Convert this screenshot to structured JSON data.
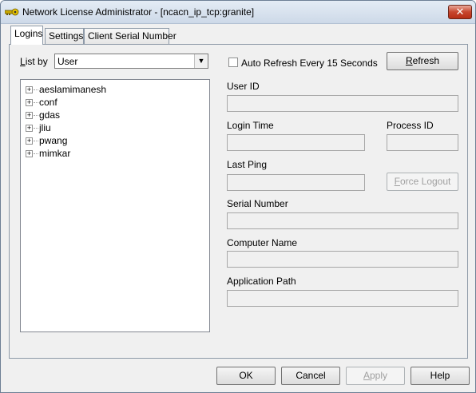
{
  "window": {
    "title": "Network License Administrator - [ncacn_ip_tcp:granite]",
    "icon": "key-icon",
    "close_glyph": "✕"
  },
  "tabs": [
    {
      "label": "Logins",
      "active": true
    },
    {
      "label": "Settings",
      "active": false
    },
    {
      "label": "Client Serial Number",
      "active": false
    }
  ],
  "list_by": {
    "label_prefix": "L",
    "label_rest": "ist by",
    "value": "User",
    "arrow": "▼"
  },
  "tree": {
    "items": [
      {
        "label": "aeslamimanesh",
        "expander": "+"
      },
      {
        "label": "conf",
        "expander": "+"
      },
      {
        "label": "gdas",
        "expander": "+"
      },
      {
        "label": "jliu",
        "expander": "+"
      },
      {
        "label": "pwang",
        "expander": "+"
      },
      {
        "label": "mimkar",
        "expander": "+"
      }
    ]
  },
  "auto_refresh": {
    "label": "Auto Refresh Every 15 Seconds",
    "checked": false
  },
  "refresh_button": {
    "label_prefix": "R",
    "label_rest": "efresh"
  },
  "fields": {
    "user_id": {
      "label": "User ID",
      "value": ""
    },
    "login_time": {
      "label": "Login Time",
      "value": ""
    },
    "process_id": {
      "label": "Process ID",
      "value": ""
    },
    "last_ping": {
      "label": "Last Ping",
      "value": ""
    },
    "serial_number": {
      "label": "Serial Number",
      "value": ""
    },
    "computer_name": {
      "label": "Computer Name",
      "value": ""
    },
    "application_path": {
      "label": "Application Path",
      "value": ""
    }
  },
  "force_logout_button": {
    "label_prefix": "F",
    "label_rest": "orce Logout",
    "enabled": false
  },
  "footer": {
    "ok": "OK",
    "cancel": "Cancel",
    "apply_prefix": "A",
    "apply_rest": "pply",
    "apply_enabled": false,
    "help": "Help"
  },
  "colors": {
    "titlebar": "#cdd9e8",
    "close_button": "#c7452d",
    "window_bg": "#f0f0f0"
  }
}
